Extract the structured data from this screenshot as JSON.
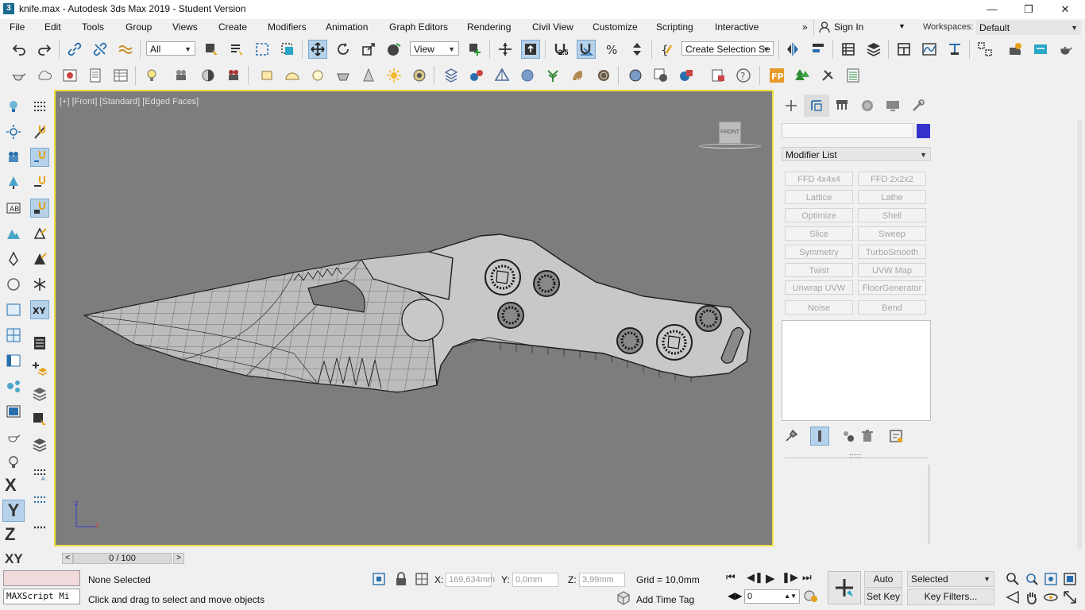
{
  "window": {
    "title": "knife.max - Autodesk 3ds Max 2019 - Student Version",
    "app_icon": "3"
  },
  "menu": {
    "items": [
      "File",
      "Edit",
      "Tools",
      "Group",
      "Views",
      "Create",
      "Modifiers",
      "Animation",
      "Graph Editors",
      "Rendering",
      "Civil View",
      "Customize",
      "Scripting",
      "Interactive"
    ],
    "more": "»",
    "sign_in": "Sign In",
    "workspaces_label": "Workspaces:",
    "workspaces_value": "Default"
  },
  "toolbar": {
    "selection_filter": "All",
    "ref_coord": "View",
    "named_selection": "Create Selection Se",
    "snap_toggle_label": "2.5"
  },
  "viewport": {
    "label": "[+] [Front] [Standard] [Edged Faces]",
    "viewcube_label": "FRONT",
    "axis_z": "z",
    "axis_x": "x"
  },
  "command_panel": {
    "tabs": [
      "create",
      "modify",
      "hierarchy",
      "motion",
      "display",
      "utilities"
    ],
    "object_color": "#3333cc",
    "modifier_list_label": "Modifier List",
    "modifier_buttons": [
      "FFD 4x4x4",
      "FFD 2x2x2",
      "Lattice",
      "Lathe",
      "Optimize",
      "Shell",
      "Slice",
      "Sweep",
      "Symmetry",
      "TurboSmooth",
      "Twist",
      "UVW Map",
      "Unwrap UVW",
      "FloorGenerator",
      "Noise",
      "Bend"
    ]
  },
  "timeline": {
    "position": "0 / 100",
    "prev": "<",
    "next": ">"
  },
  "status": {
    "maxscript_placeholder": "MAXScript Mi",
    "selection_status": "None Selected",
    "prompt": "Click and drag to select and move objects",
    "x_label": "X:",
    "x_value": "169,634mm",
    "y_label": "Y:",
    "y_value": "0,0mm",
    "z_label": "Z:",
    "z_value": "3,99mm",
    "grid": "Grid = 10,0mm",
    "add_time_tag": "Add Time Tag",
    "auto_key": "Auto Key",
    "set_key": "Set Key",
    "key_mode": "Selected",
    "key_filters": "Key Filters...",
    "frame": "0"
  },
  "left_axes": [
    "X",
    "Y",
    "Z",
    "XY"
  ],
  "colors": {
    "viewport_bg": "#7d7d7d",
    "viewport_border": "#f0e041",
    "accent": "#b6d2ea",
    "maxscript_bg": "#f2d9db"
  }
}
